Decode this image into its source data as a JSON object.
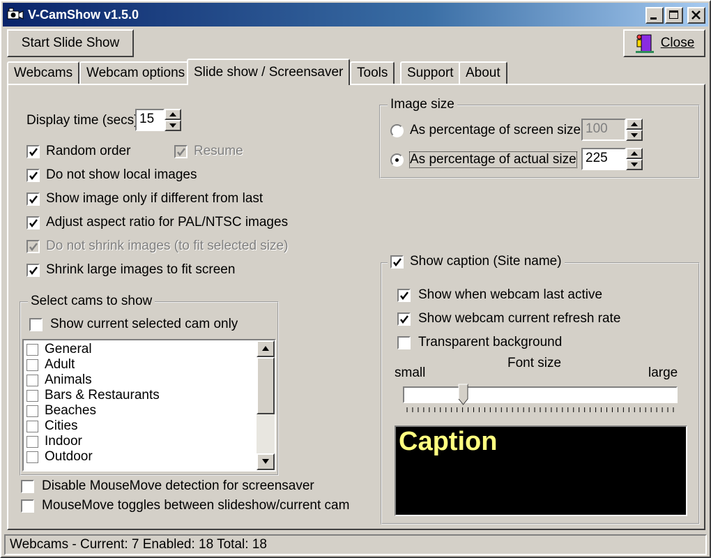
{
  "window": {
    "title": "V-CamShow v1.5.0"
  },
  "toolbar": {
    "start_label": "Start Slide Show",
    "close_label": "Close"
  },
  "tabs": [
    {
      "label": "Webcams"
    },
    {
      "label": "Webcam options"
    },
    {
      "label": "Slide show / Screensaver",
      "active": true
    },
    {
      "label": "Tools"
    },
    {
      "label": "Support"
    },
    {
      "label": "About"
    }
  ],
  "display_time": {
    "label": "Display time (secs)",
    "value": "15"
  },
  "options": {
    "random_order": {
      "label": "Random order",
      "checked": true
    },
    "resume": {
      "label": "Resume",
      "checked": true,
      "disabled": true
    },
    "no_local": {
      "label": "Do not show local images",
      "checked": true
    },
    "only_diff": {
      "label": "Show image only if different from last",
      "checked": true
    },
    "aspect": {
      "label": "Adjust aspect ratio for PAL/NTSC images",
      "checked": true
    },
    "no_shrink": {
      "label": "Do not shrink images (to fit selected size)",
      "checked": true,
      "disabled": true
    },
    "shrink_large": {
      "label": "Shrink large images to fit screen",
      "checked": true
    }
  },
  "select_cams": {
    "legend": "Select cams to show",
    "current_only": {
      "label": "Show current selected cam only",
      "checked": false
    },
    "items": [
      "General",
      "Adult",
      "Animals",
      "Bars & Restaurants",
      "Beaches",
      "Cities",
      "Indoor",
      "Outdoor"
    ]
  },
  "mouse": {
    "disable": {
      "label": "Disable MouseMove detection for screensaver",
      "checked": false
    },
    "toggle": {
      "label": "MouseMove toggles between slideshow/current cam",
      "checked": false
    }
  },
  "image_size": {
    "legend": "Image size",
    "screen": {
      "label": "As percentage of screen size",
      "value": "100",
      "selected": false
    },
    "actual": {
      "label": "As percentage of actual size",
      "value": "225",
      "selected": true
    }
  },
  "caption": {
    "legend": "Show caption (Site name)",
    "checked": true,
    "last_active": {
      "label": "Show when webcam last active",
      "checked": true
    },
    "refresh_rate": {
      "label": "Show webcam current refresh rate",
      "checked": true
    },
    "transparent": {
      "label": "Transparent background",
      "checked": false
    },
    "font_size": {
      "label": "Font size",
      "min_label": "small",
      "max_label": "large",
      "level": 0.21
    },
    "preview": "Caption"
  },
  "colors": {
    "caption_text": "#ffff80",
    "caption_bg": "#000000",
    "title_start": "#0a246a",
    "title_end": "#a6caf0"
  },
  "status": "Webcams - Current: 7  Enabled: 18  Total: 18"
}
